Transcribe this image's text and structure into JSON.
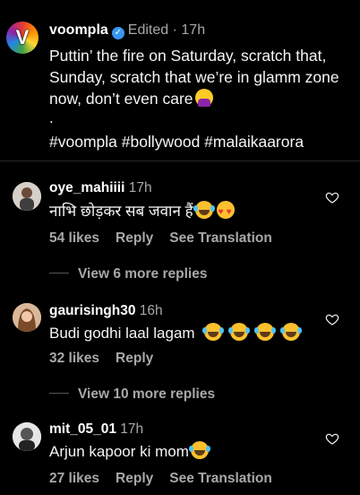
{
  "post": {
    "avatar_letter": "V",
    "username": "voompla",
    "verified": true,
    "edited": "Edited",
    "separator": "·",
    "time": "17h",
    "caption_text": "Puttin’ the fire on Saturday, scratch that, Sunday, scratch that we’re in glamm zone now, don’t even care",
    "caption_emoji": "shrug-emoji",
    "dot": ".",
    "hashtags": "#voompla #bollywood #malaikaarora"
  },
  "comments": [
    {
      "username": "oye_mahiiii",
      "time": "17h",
      "text": "नाभि छोड़कर सब जवान हैं",
      "emojis": [
        "laughing-tears-emoji",
        "heart-eyes-emoji"
      ],
      "likes": "54 likes",
      "reply_label": "Reply",
      "translate_label": "See Translation",
      "view_replies": "View 6 more replies",
      "avatar_color": "#c8c2b8"
    },
    {
      "username": "gaurisingh30",
      "time": "16h",
      "text": "Budi godhi laal lagam",
      "emojis": [
        "laughing-tears-emoji",
        "laughing-tears-emoji",
        "laughing-tears-emoji",
        "laughing-tears-emoji"
      ],
      "likes": "32 likes",
      "reply_label": "Reply",
      "view_replies": "View 10 more replies",
      "avatar_color": "#b07a5a"
    },
    {
      "username": "mit_05_01",
      "time": "17h",
      "text": "Arjun kapoor ki mom",
      "emojis": [
        "laughing-tears-emoji"
      ],
      "likes": "27 likes",
      "reply_label": "Reply",
      "translate_label": "See Translation",
      "avatar_color": "#d9d9d9"
    }
  ],
  "colors": {
    "background": "#000000",
    "text": "#f5f5f5",
    "muted": "#a8a8a8",
    "verified": "#3897f0"
  }
}
